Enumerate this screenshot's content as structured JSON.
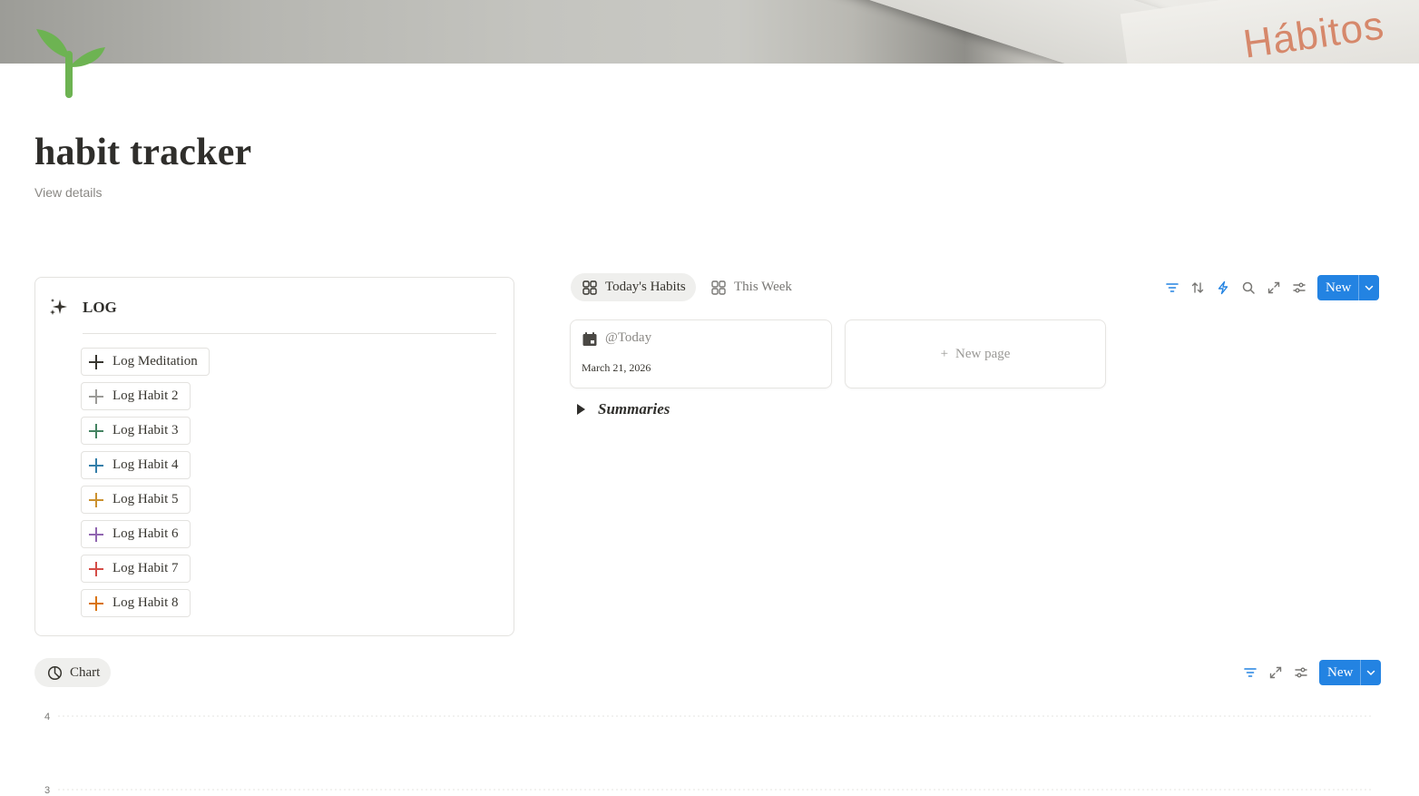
{
  "page": {
    "title": "habit tracker",
    "view_details": "View details",
    "icon": "sprout-icon"
  },
  "cover": {
    "book_text": "Hábitos"
  },
  "log": {
    "icon": "sparkles-icon",
    "title": "LOG",
    "buttons": [
      {
        "label": "Log Meditation",
        "color": "#37352f"
      },
      {
        "label": "Log Habit 2",
        "color": "#9b9a97"
      },
      {
        "label": "Log Habit 3",
        "color": "#448361"
      },
      {
        "label": "Log Habit 4",
        "color": "#337ea9"
      },
      {
        "label": "Log Habit 5",
        "color": "#cb912f"
      },
      {
        "label": "Log Habit 6",
        "color": "#9065b0"
      },
      {
        "label": "Log Habit 7",
        "color": "#d44c47"
      },
      {
        "label": "Log Habit 8",
        "color": "#d9730d"
      }
    ]
  },
  "database": {
    "tabs": [
      {
        "label": "Today's Habits",
        "icon": "gallery-icon",
        "active": true
      },
      {
        "label": "This Week",
        "icon": "gallery-icon",
        "active": false
      }
    ],
    "toolbar": {
      "icons": [
        "filter-icon",
        "sort-icon",
        "lightning-icon",
        "search-icon",
        "expand-icon",
        "settings-icon"
      ],
      "new_label": "New"
    },
    "card": {
      "title": "@Today",
      "date": "March 21, 2026",
      "icon": "calendar-icon"
    },
    "new_page_label": "New page",
    "summaries_label": "Summaries"
  },
  "chart_section": {
    "tab_label": "Chart",
    "tab_icon": "pie-chart-icon",
    "toolbar": {
      "icons": [
        "filter-icon",
        "expand-icon",
        "settings-icon"
      ],
      "new_label": "New"
    }
  },
  "chart_data": {
    "type": "bar",
    "y_ticks": [
      4,
      3
    ],
    "grid": true
  },
  "colors": {
    "accent": "#2383e2",
    "sprout": "#6db352"
  }
}
